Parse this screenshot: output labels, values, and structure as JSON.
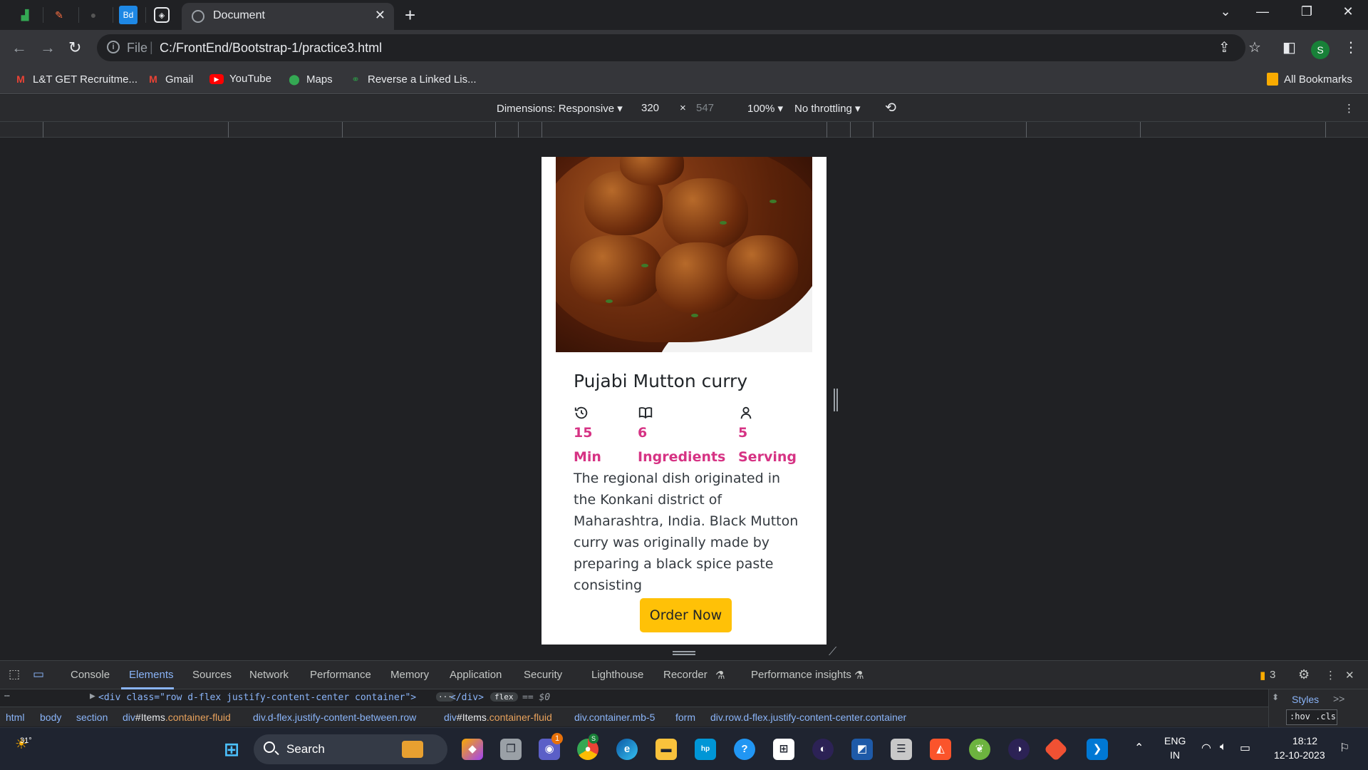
{
  "browser": {
    "active_tab_title": "Document",
    "url_scheme": "File",
    "url": "C:/FrontEnd/Bootstrap-1/practice3.html",
    "profile_initial": "S",
    "pinned_tabs": [
      "sheets",
      "pencil",
      "dark",
      "Bd",
      "codepen"
    ]
  },
  "bookmarks": {
    "items": [
      {
        "label": "L&T GET Recruitme...",
        "icon": "gmail-icon"
      },
      {
        "label": "Gmail",
        "icon": "gmail-icon"
      },
      {
        "label": "YouTube",
        "icon": "youtube-icon"
      },
      {
        "label": "Maps",
        "icon": "maps-icon"
      },
      {
        "label": "Reverse a Linked Lis...",
        "icon": "gfg-icon"
      }
    ],
    "all_bookmarks": "All Bookmarks"
  },
  "device_toolbar": {
    "dimensions": "Dimensions: Responsive",
    "width": "320",
    "times": "×",
    "height": "547",
    "zoom": "100%",
    "throttling": "No throttling"
  },
  "card": {
    "title": "Pujabi Mutton curry",
    "stats": [
      {
        "icon": "clock-history-icon",
        "number": "15",
        "label": "Min"
      },
      {
        "icon": "book-icon",
        "number": "6",
        "label": "Ingredients"
      },
      {
        "icon": "person-icon",
        "number": "5",
        "label": "Serving"
      }
    ],
    "description": "The regional dish originated in the Konkani district of Maharashtra, India. Black Mutton curry was originally made by preparing a black spice paste consisting",
    "button": "Order Now",
    "accent_color": "#d63384",
    "button_color": "#ffc107"
  },
  "devtools": {
    "tabs": [
      "Console",
      "Elements",
      "Sources",
      "Network",
      "Performance",
      "Memory",
      "Application",
      "Security",
      "Lighthouse",
      "Recorder",
      "Performance insights"
    ],
    "active_tab": "Elements",
    "issues_count": "3",
    "dom_line": {
      "open": "<div class=\"row d-flex justify-content-center container\">",
      "ellipsis": "···",
      "close": "</div>",
      "badge": "flex",
      "eq": "== $0"
    },
    "breadcrumbs": [
      {
        "text": "html"
      },
      {
        "text": "body"
      },
      {
        "text": "section"
      },
      {
        "prefix": "div",
        "hash": "#Items",
        "cls": ".container-fluid"
      },
      {
        "text": "div.d-flex.justify-content-between.row"
      },
      {
        "prefix": "div",
        "hash": "#Items",
        "cls": ".container-fluid"
      },
      {
        "text": "div.container.mb-5"
      },
      {
        "text": "form"
      },
      {
        "text": "div.row.d-flex.justify-content-center.container"
      }
    ],
    "styles_tab": "Styles",
    "styles_more": ">>",
    "hov_cls": ":hov .cls"
  },
  "taskbar": {
    "weather": "31°",
    "search": "Search",
    "lang_top": "ENG",
    "lang_bottom": "IN",
    "time": "18:12",
    "date": "12-10-2023",
    "chrome_badge": "S",
    "teams_badge": "1"
  }
}
